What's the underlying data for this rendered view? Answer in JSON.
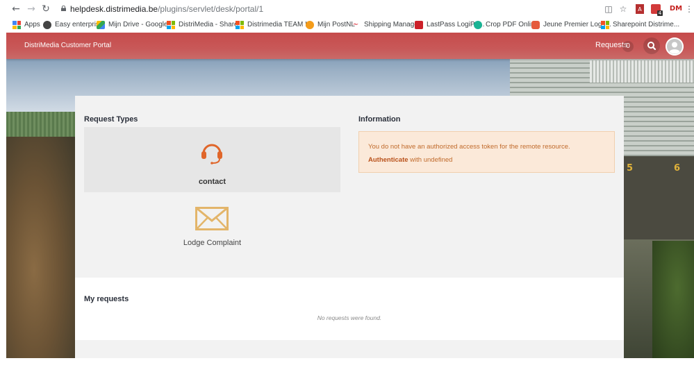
{
  "browser": {
    "url_host": "helpdesk.distrimedia.be",
    "url_path": "/plugins/servlet/desk/portal/1",
    "profile_initials": "DM",
    "pdf_badge": "4"
  },
  "bookmarks": [
    {
      "label": "Apps"
    },
    {
      "label": "Easy enterprise"
    },
    {
      "label": "Mijn Drive - Google..."
    },
    {
      "label": "DistriMedia - Share..."
    },
    {
      "label": "Distrimedia TEAM I..."
    },
    {
      "label": "Mijn PostNL"
    },
    {
      "label": "Shipping Manager"
    },
    {
      "label": "LastPass LogiPL..."
    },
    {
      "label": "Crop PDF Online"
    },
    {
      "label": "Jeune Premier Log i..."
    },
    {
      "label": "Sharepoint Distrime..."
    }
  ],
  "portal": {
    "title": "DistriMedia Customer Portal",
    "requests_label": "Requests",
    "requests_count": "0"
  },
  "request_types": {
    "heading": "Request Types",
    "items": [
      {
        "label": "contact",
        "icon": "headset-icon"
      },
      {
        "label": "Lodge Complaint",
        "icon": "envelope-icon"
      }
    ]
  },
  "information": {
    "heading": "Information",
    "message": "You do not have an authorized access token for the remote resource.",
    "auth_link": "Authenticate",
    "auth_suffix": " with undefined"
  },
  "my_requests": {
    "heading": "My requests",
    "empty_text": "No requests were found."
  },
  "colors": {
    "header": "#c85858",
    "info_bg": "#fbe9d9",
    "info_text": "#c06a2b",
    "icon_orange": "#e0662a",
    "icon_gold": "#e3b56a"
  }
}
